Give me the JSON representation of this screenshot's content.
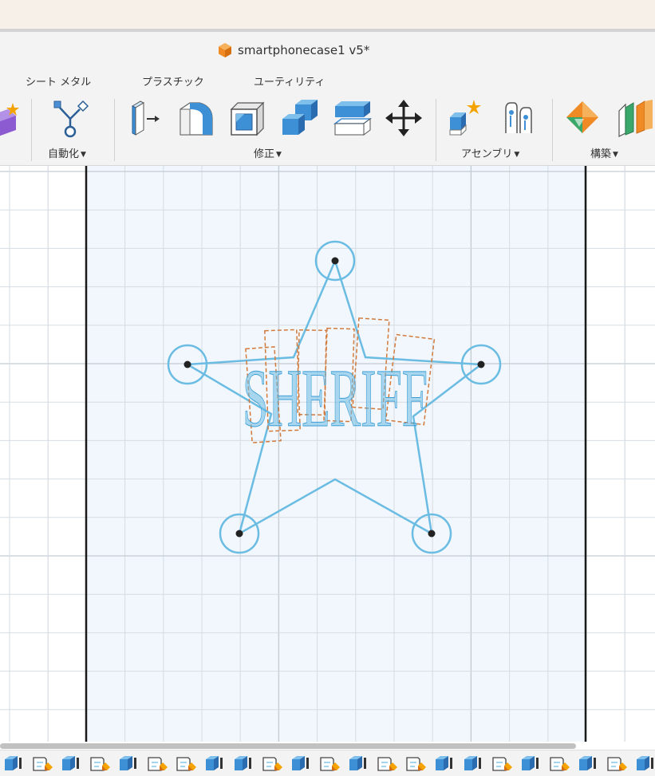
{
  "window": {
    "document_title": "smartphonecase1 v5*"
  },
  "ribbon": {
    "tabs": [
      {
        "label": "シート メタル"
      },
      {
        "label": "プラスチック"
      },
      {
        "label": "ユーティリティ"
      }
    ],
    "groups": {
      "automate": {
        "label": "自動化"
      },
      "modify": {
        "label": "修正"
      },
      "assemble": {
        "label": "アセンブリ"
      },
      "construct": {
        "label": "構築"
      }
    },
    "tools": [
      {
        "name": "new-component-icon"
      },
      {
        "name": "automate-icon"
      },
      {
        "name": "press-pull-icon"
      },
      {
        "name": "fillet-icon"
      },
      {
        "name": "shell-icon"
      },
      {
        "name": "combine-icon"
      },
      {
        "name": "offset-face-icon"
      },
      {
        "name": "move-copy-icon"
      },
      {
        "name": "new-component-assembly-icon"
      },
      {
        "name": "joint-icon"
      },
      {
        "name": "offset-plane-icon"
      },
      {
        "name": "midplane-icon"
      }
    ]
  },
  "canvas": {
    "sketch_text": "SHERIFF",
    "colors": {
      "sketch_line": "#6bbce3",
      "text_box": "#d27a3c",
      "profile_fill": "#eef6fc",
      "grid_line": "#d6dde2",
      "major_grid_line": "#c4ccd2",
      "body_edge": "#1a1a1a"
    }
  },
  "timeline": {
    "items": [
      {
        "type": "body"
      },
      {
        "type": "sketch"
      },
      {
        "type": "body"
      },
      {
        "type": "sketch"
      },
      {
        "type": "body"
      },
      {
        "type": "sketch"
      },
      {
        "type": "sketch"
      },
      {
        "type": "body"
      },
      {
        "type": "body"
      },
      {
        "type": "sketch"
      },
      {
        "type": "body"
      },
      {
        "type": "sketch"
      },
      {
        "type": "body"
      },
      {
        "type": "sketch"
      },
      {
        "type": "sketch"
      },
      {
        "type": "body"
      },
      {
        "type": "body"
      },
      {
        "type": "sketch"
      },
      {
        "type": "body"
      },
      {
        "type": "sketch"
      },
      {
        "type": "body"
      },
      {
        "type": "sketch"
      },
      {
        "type": "body"
      }
    ]
  },
  "accent_colors": {
    "tool_blue": "#3d8fd6",
    "tool_light_blue": "#7fbfeb",
    "spark_orange": "#f5a300",
    "brand_orange": "#f08a24"
  }
}
